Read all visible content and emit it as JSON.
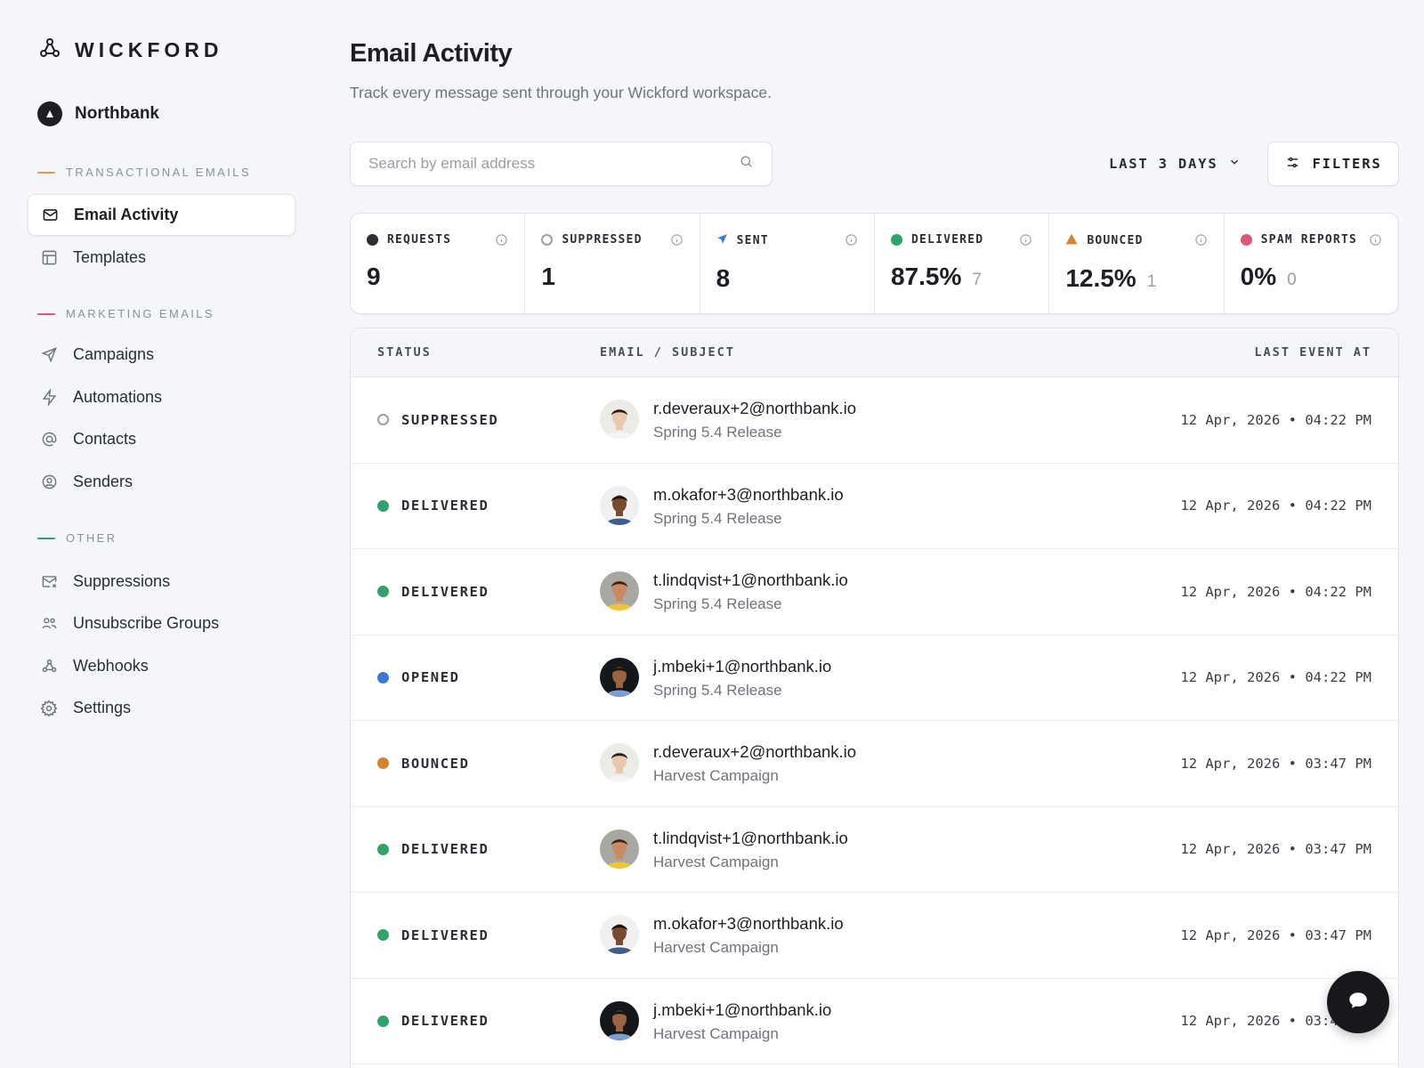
{
  "brand": {
    "name": "WICKFORD"
  },
  "workspace": {
    "name": "Northbank"
  },
  "sidebar": {
    "sections": [
      {
        "title": "TRANSACTIONAL EMAILS",
        "color": "#e29a4a"
      },
      {
        "title": "MARKETING EMAILS",
        "color": "#d85a78"
      },
      {
        "title": "OTHER",
        "color": "#2fa36b"
      }
    ],
    "items": [
      {
        "label": "Email Activity",
        "icon": "mail-icon",
        "active": true
      },
      {
        "label": "Templates",
        "icon": "template-icon"
      },
      {
        "label": "Campaigns",
        "icon": "send-icon"
      },
      {
        "label": "Automations",
        "icon": "bolt-icon"
      },
      {
        "label": "Contacts",
        "icon": "at-icon"
      },
      {
        "label": "Senders",
        "icon": "user-circle-icon"
      },
      {
        "label": "Suppressions",
        "icon": "mail-x-icon"
      },
      {
        "label": "Unsubscribe Groups",
        "icon": "users-icon"
      },
      {
        "label": "Webhooks",
        "icon": "webhook-icon"
      },
      {
        "label": "Settings",
        "icon": "gear-icon"
      }
    ]
  },
  "header": {
    "title": "Email Activity",
    "subtitle": "Track every message sent through your Wickford workspace."
  },
  "toolbar": {
    "search_placeholder": "Search by email address",
    "range_label": "LAST 3 DAYS",
    "filters_label": "FILTERS"
  },
  "stats": [
    {
      "label": "REQUESTS",
      "value": "9",
      "sub": "",
      "color": "#2b2e34"
    },
    {
      "label": "SUPPRESSED",
      "value": "1",
      "sub": "",
      "color": "#9aa0a8"
    },
    {
      "label": "SENT",
      "value": "8",
      "sub": "",
      "color": "#3b7bd4"
    },
    {
      "label": "DELIVERED",
      "value": "87.5%",
      "sub": "7",
      "color": "#2fa36b"
    },
    {
      "label": "BOUNCED",
      "value": "12.5%",
      "sub": "1",
      "color": "#d4852d"
    },
    {
      "label": "SPAM REPORTS",
      "value": "0%",
      "sub": "0",
      "color": "#d85a78"
    }
  ],
  "table": {
    "headers": {
      "status": "STATUS",
      "email": "EMAIL / SUBJECT",
      "time": "LAST EVENT AT"
    },
    "rows": [
      {
        "status": "SUPPRESSED",
        "email": "r.deveraux+2@northbank.io",
        "subject": "Spring 5.4 Release",
        "time": "12 Apr, 2026 • 04:22 PM"
      },
      {
        "status": "DELIVERED",
        "email": "m.okafor+3@northbank.io",
        "subject": "Spring 5.4 Release",
        "time": "12 Apr, 2026 • 04:22 PM"
      },
      {
        "status": "DELIVERED",
        "email": "t.lindqvist+1@northbank.io",
        "subject": "Spring 5.4 Release",
        "time": "12 Apr, 2026 • 04:22 PM"
      },
      {
        "status": "OPENED",
        "email": "j.mbeki+1@northbank.io",
        "subject": "Spring 5.4 Release",
        "time": "12 Apr, 2026 • 04:22 PM"
      },
      {
        "status": "BOUNCED",
        "email": "r.deveraux+2@northbank.io",
        "subject": "Harvest Campaign",
        "time": "12 Apr, 2026 • 03:47 PM"
      },
      {
        "status": "DELIVERED",
        "email": "t.lindqvist+1@northbank.io",
        "subject": "Harvest Campaign",
        "time": "12 Apr, 2026 • 03:47 PM"
      },
      {
        "status": "DELIVERED",
        "email": "m.okafor+3@northbank.io",
        "subject": "Harvest Campaign",
        "time": "12 Apr, 2026 • 03:47 PM"
      },
      {
        "status": "DELIVERED",
        "email": "j.mbeki+1@northbank.io",
        "subject": "Harvest Campaign",
        "time": "12 Apr, 2026 • 03:47 PM"
      }
    ]
  },
  "status_colors": {
    "SUPPRESSED": "#9aa0a8",
    "DELIVERED": "#2fa36b",
    "OPENED": "#3b7bd4",
    "BOUNCED": "#d4852d"
  }
}
